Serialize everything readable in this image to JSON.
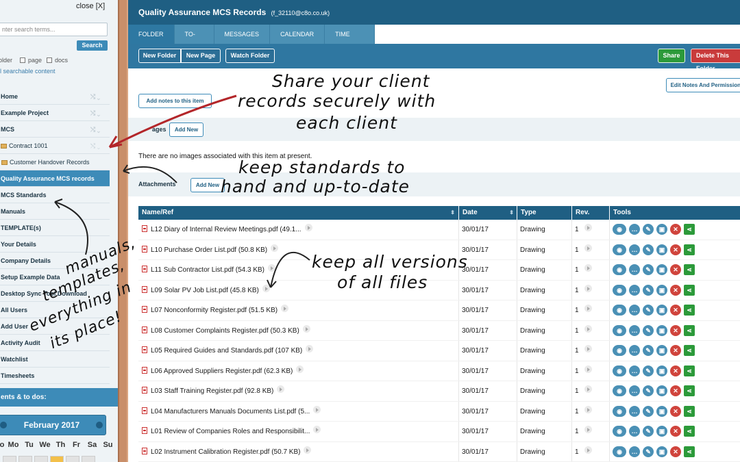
{
  "sidebar": {
    "close_label": "close [X]",
    "search_placeholder": "nter search terms...",
    "search_button": "Search",
    "scope": {
      "folder": "older",
      "page": "page",
      "docs": "docs"
    },
    "searchable_note": "ll searchable content",
    "nav_items": [
      {
        "label": "Home"
      },
      {
        "label": "Example Project"
      },
      {
        "label": "MCS"
      },
      {
        "label": "Contract 1001"
      },
      {
        "label": "Customer Handover Records"
      },
      {
        "label": "Quality Assurance MCS records"
      },
      {
        "label": "MCS Standards"
      },
      {
        "label": "Manuals"
      },
      {
        "label": "TEMPLATE(s)"
      },
      {
        "label": "Your Details"
      },
      {
        "label": "Company Details"
      },
      {
        "label": "Setup Example Data"
      },
      {
        "label": "Desktop Sync Tool Download"
      },
      {
        "label": "All Users"
      },
      {
        "label": "Add User"
      },
      {
        "label": "Activity Audit"
      },
      {
        "label": "Watchlist"
      },
      {
        "label": "Timesheets"
      }
    ],
    "events_header": "ents & to dos:",
    "calendar": {
      "month": "February 2017",
      "weekdays": [
        "o",
        "Mo",
        "Tu",
        "We",
        "Th",
        "Fr",
        "Sa",
        "Su"
      ]
    }
  },
  "header": {
    "title": "Quality Assurance MCS Records",
    "user": "(f_32110@c8o.co.uk)"
  },
  "tabs": [
    "FOLDER",
    "TO-DOS",
    "MESSAGES",
    "CALENDAR",
    "TIME SHEET"
  ],
  "toolbar": {
    "new_folder": "New Folder",
    "new_page": "New Page",
    "watch_folder": "Watch Folder",
    "share": "Share",
    "delete_folder": "Delete This Folder"
  },
  "notes": {
    "add_notes": "Add notes to this item",
    "edit_notes": "Edit Notes And Permissions"
  },
  "images": {
    "label": "ages",
    "add_new": "Add New",
    "empty_message": "There are no images associated with this item at present."
  },
  "attachments": {
    "label": "Attachments",
    "add_new": "Add New",
    "columns": [
      "Name/Ref",
      "Date",
      "Type",
      "Rev.",
      "Tools"
    ],
    "rows": [
      {
        "name": "L12 Diary of Internal Review Meetings.pdf (49.1...",
        "date": "30/01/17",
        "type": "Drawing",
        "rev": "1"
      },
      {
        "name": "L10 Purchase Order List.pdf (50.8 KB)",
        "date": "30/01/17",
        "type": "Drawing",
        "rev": "1"
      },
      {
        "name": "L11 Sub Contractor List.pdf (54.3 KB)",
        "date": "30/01/17",
        "type": "Drawing",
        "rev": "1"
      },
      {
        "name": "L09 Solar PV Job List.pdf (45.8 KB)",
        "date": "30/01/17",
        "type": "Drawing",
        "rev": "1"
      },
      {
        "name": "L07 Nonconformity Register.pdf (51.5 KB)",
        "date": "30/01/17",
        "type": "Drawing",
        "rev": "1"
      },
      {
        "name": "L08 Customer Complaints Register.pdf (50.3 KB)",
        "date": "30/01/17",
        "type": "Drawing",
        "rev": "1"
      },
      {
        "name": "L05 Required Guides and Standards.pdf (107 KB)",
        "date": "30/01/17",
        "type": "Drawing",
        "rev": "1"
      },
      {
        "name": "L06 Approved Suppliers Register.pdf (62.3 KB)",
        "date": "30/01/17",
        "type": "Drawing",
        "rev": "1"
      },
      {
        "name": "L03 Staff Training Register.pdf (92.8 KB)",
        "date": "30/01/17",
        "type": "Drawing",
        "rev": "1"
      },
      {
        "name": "L04 Manufacturers Manuals Documents List.pdf (5...",
        "date": "30/01/17",
        "type": "Drawing",
        "rev": "1"
      },
      {
        "name": "L01 Review of Companies Roles and Responsibilit...",
        "date": "30/01/17",
        "type": "Drawing",
        "rev": "1"
      },
      {
        "name": "L02 Instrument Calibration Register.pdf (50.7 KB)",
        "date": "30/01/17",
        "type": "Drawing",
        "rev": "1"
      }
    ]
  },
  "annotations": {
    "share": [
      "Share your client",
      "records securely with",
      "each client"
    ],
    "standards": [
      "keep standards to",
      "hand and up-to-date"
    ],
    "versions": [
      "keep all versions",
      "of all files"
    ],
    "manuals": [
      "manuals,",
      "templates,",
      "everything in",
      "its place!"
    ]
  }
}
